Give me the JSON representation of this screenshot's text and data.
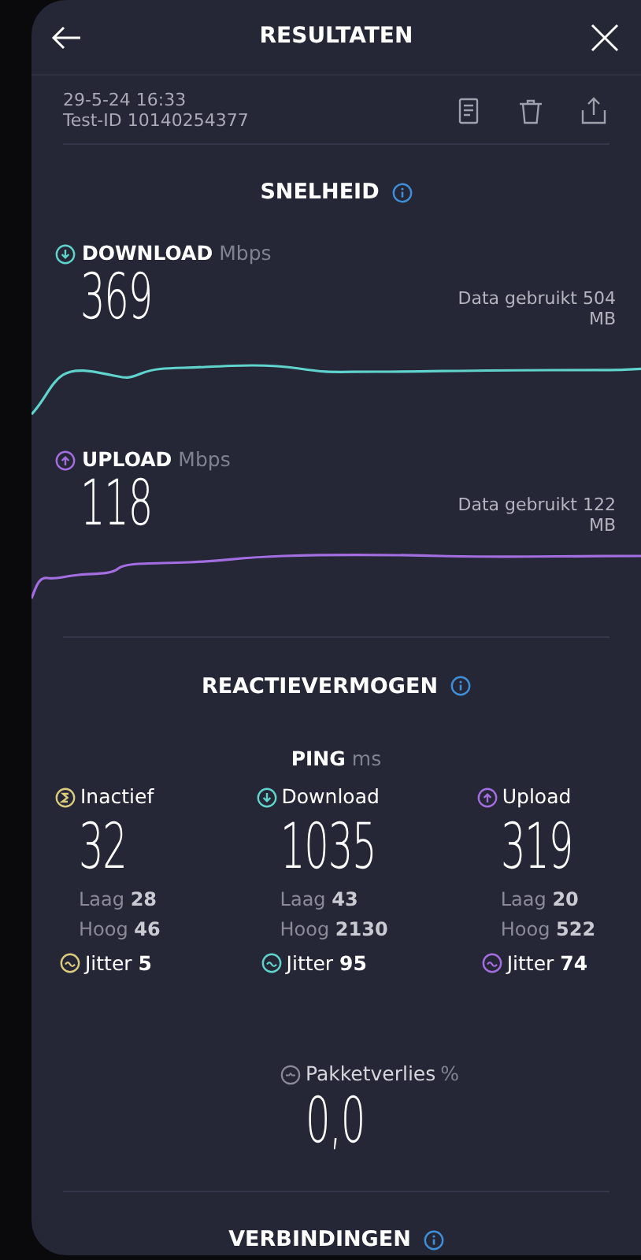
{
  "header": {
    "title": "RESULTATEN"
  },
  "meta": {
    "date": "29-5-24 16:33",
    "test_id": "Test-ID 10140254377"
  },
  "speed": {
    "title": "SNELHEID",
    "metrics": [
      {
        "kind": "download",
        "label": "DOWNLOAD",
        "unit": "Mbps",
        "value": "369",
        "data_used": "Data gebruikt 504 MB",
        "color": "#5fd3cc"
      },
      {
        "kind": "upload",
        "label": "UPLOAD",
        "unit": "Mbps",
        "value": "118",
        "data_used": "Data gebruikt 122 MB",
        "color": "#a36ee0"
      }
    ]
  },
  "responsiveness": {
    "title": "REACTIEVERMOGEN",
    "ping_label": "PING",
    "ping_unit": "ms",
    "columns": [
      {
        "kind": "idle",
        "label": "Inactief",
        "value": "32",
        "low_label": "Laag",
        "low": "28",
        "high_label": "Hoog",
        "high": "46",
        "jitter_label": "Jitter",
        "jitter": "5",
        "color": "#dccb7c"
      },
      {
        "kind": "download",
        "label": "Download",
        "value": "1035",
        "low_label": "Laag",
        "low": "43",
        "high_label": "Hoog",
        "high": "2130",
        "jitter_label": "Jitter",
        "jitter": "95",
        "color": "#5fd3cc"
      },
      {
        "kind": "upload",
        "label": "Upload",
        "value": "319",
        "low_label": "Laag",
        "low": "20",
        "high_label": "Hoog",
        "high": "522",
        "jitter_label": "Jitter",
        "jitter": "74",
        "color": "#a36ee0"
      }
    ],
    "packet_loss": {
      "label": "Pakketverlies",
      "unit": "%",
      "value": "0,0"
    }
  },
  "connections": {
    "title": "VERBINDINGEN"
  }
}
